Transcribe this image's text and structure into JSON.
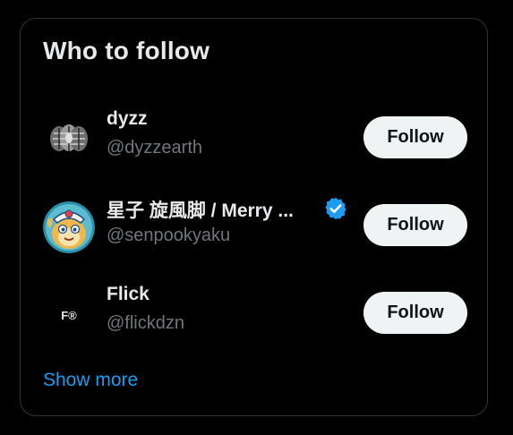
{
  "widget": {
    "title": "Who to follow",
    "show_more_label": "Show more"
  },
  "suggestions": [
    {
      "name": "dyzz",
      "handle": "@dyzzearth",
      "follow_label": "Follow",
      "verified": false,
      "avatar": "metallic-sculpture-avatar"
    },
    {
      "name": "星子 旋風脚 / Merry ...",
      "handle": "@senpookyaku",
      "follow_label": "Follow",
      "verified": true,
      "avatar": "cartoon-character-avatar"
    },
    {
      "name": "Flick",
      "handle": "@flickdzn",
      "follow_label": "Follow",
      "verified": false,
      "avatar": "f-logo-avatar",
      "avatar_text": "F®"
    }
  ],
  "colors": {
    "background": "#000000",
    "border": "#2f3336",
    "text_primary": "#e7e9ea",
    "text_secondary": "#71767b",
    "button_bg": "#eff3f4",
    "accent": "#1d9bf0"
  }
}
